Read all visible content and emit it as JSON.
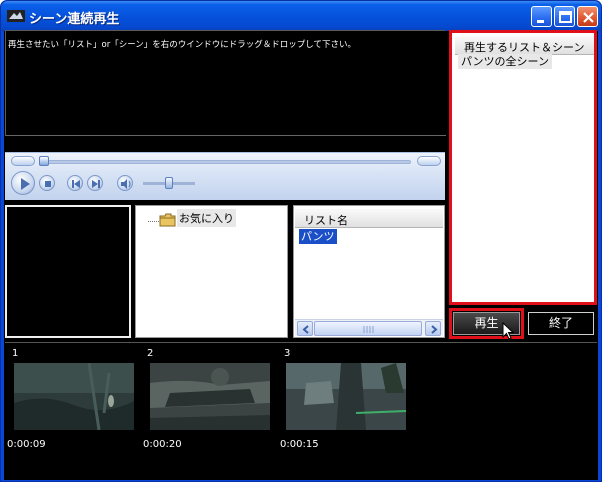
{
  "window": {
    "title": "シーン連続再生"
  },
  "video": {
    "instruction": "再生させたい「リスト」or「シーン」を右のウインドウにドラッグ＆ドロップして下さい。"
  },
  "tree": {
    "favorites_label": "お気に入り"
  },
  "list": {
    "header": "リスト名",
    "items": [
      "パンツ"
    ]
  },
  "play_list": {
    "header": "再生するリスト＆シーン",
    "items": [
      "パンツの全シーン"
    ]
  },
  "buttons": {
    "play_label": "再生",
    "end_label": "終了"
  },
  "scenes": [
    {
      "number": "1",
      "time": "0:00:09"
    },
    {
      "number": "2",
      "time": "0:00:20"
    },
    {
      "number": "3",
      "time": "0:00:15"
    }
  ],
  "colors": {
    "highlight_border": "#e0101a",
    "selection": "#1a4fc8",
    "titlebar": "#0653dc"
  }
}
